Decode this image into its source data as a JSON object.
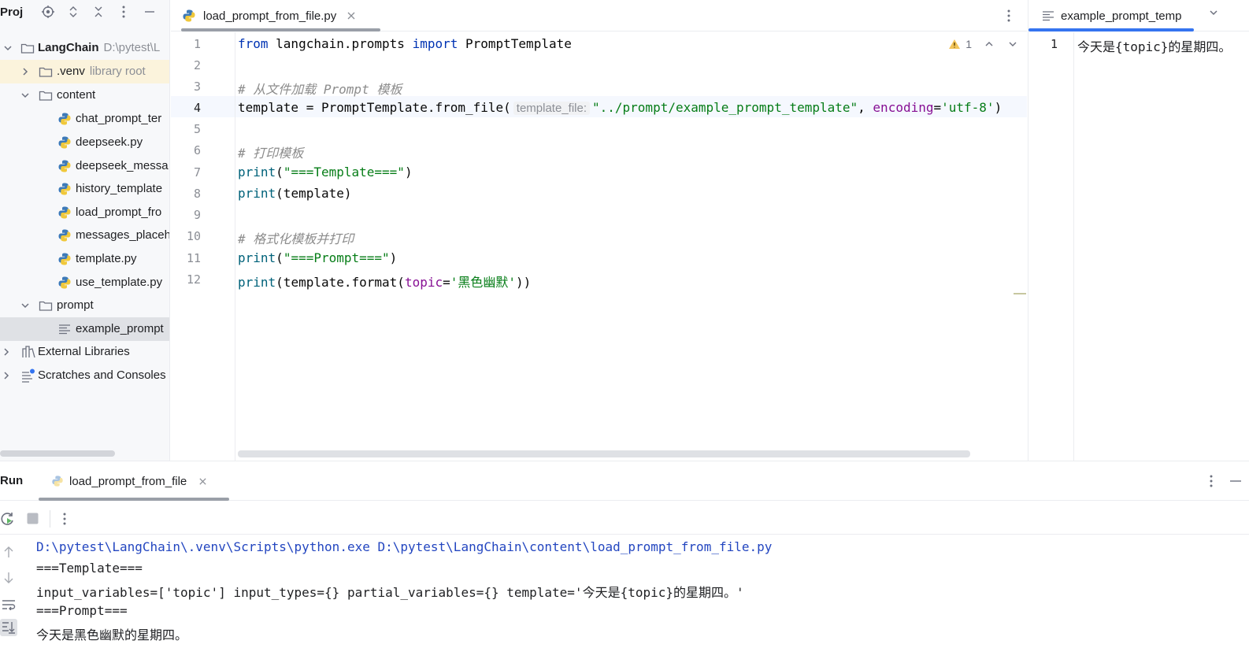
{
  "project": {
    "title": "Proj",
    "tree": [
      {
        "label": "LangChain",
        "hint": "D:\\pytest\\L"
      },
      {
        "label": ".venv",
        "hint": "library root"
      },
      {
        "label": "content"
      },
      {
        "label": "chat_prompt_ter"
      },
      {
        "label": "deepseek.py"
      },
      {
        "label": "deepseek_messa"
      },
      {
        "label": "history_template"
      },
      {
        "label": "load_prompt_fro"
      },
      {
        "label": "messages_placeh"
      },
      {
        "label": "template.py"
      },
      {
        "label": "use_template.py"
      },
      {
        "label": "prompt"
      },
      {
        "label": "example_prompt"
      },
      {
        "label": "External Libraries"
      },
      {
        "label": "Scratches and Consoles"
      }
    ]
  },
  "editor": {
    "tab_label": "load_prompt_from_file.py",
    "warning_count": "1",
    "line_numbers": [
      "1",
      "2",
      "3",
      "4",
      "5",
      "6",
      "7",
      "8",
      "9",
      "10",
      "11",
      "12"
    ],
    "code": {
      "l1_kw1": "from",
      "l1_mod": " langchain.prompts ",
      "l1_kw2": "import",
      "l1_cls": " PromptTemplate",
      "l3_comment": "# 从文件加载 Prompt 模板",
      "l4_a": "template = PromptTemplate.from_file(",
      "l4_hint": "template_file:",
      "l4_str": "\"../prompt/example_prompt_template\"",
      "l4_comma": ", ",
      "l4_param": "encoding",
      "l4_eq": "=",
      "l4_str2": "'utf-8'",
      "l4_close": ")",
      "l6_comment": "# 打印模板",
      "l7_fn": "print",
      "l7_open": "(",
      "l7_str": "\"===Template===\"",
      "l7_close": ")",
      "l8_fn": "print",
      "l8_rest": "(template)",
      "l10_comment": "# 格式化模板并打印",
      "l11_fn": "print",
      "l11_open": "(",
      "l11_str": "\"===Prompt===\"",
      "l11_close": ")",
      "l12_fn": "print",
      "l12_a": "(template.format(",
      "l12_param": "topic",
      "l12_eq": "=",
      "l12_str": "'黑色幽默'",
      "l12_close": "))"
    }
  },
  "right_editor": {
    "tab_label": "example_prompt_temp",
    "line_number": "1",
    "content": "今天是{topic}的星期四。"
  },
  "run": {
    "title": "Run",
    "tab_label": "load_prompt_from_file",
    "output": [
      "D:\\pytest\\LangChain\\.venv\\Scripts\\python.exe D:\\pytest\\LangChain\\content\\load_prompt_from_file.py",
      "===Template===",
      "input_variables=['topic'] input_types={} partial_variables={} template='今天是{topic}的星期四。'",
      "===Prompt===",
      "今天是黑色幽默的星期四。"
    ]
  },
  "colors": {
    "accent": "#3574f0",
    "keyword": "#0033b3",
    "string": "#067d17",
    "comment": "#8c8c8c",
    "param": "#871094"
  }
}
